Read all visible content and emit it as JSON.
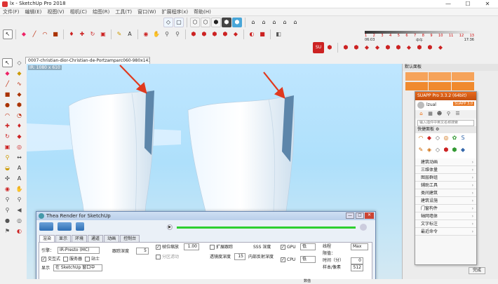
{
  "window": {
    "title": "lx - SketchUp Pro 2018",
    "minimize": "—",
    "maximize": "☐",
    "close": "✕"
  },
  "menu": [
    "文件(F)",
    "编辑(E)",
    "视图(V)",
    "相机(C)",
    "绘图(R)",
    "工具(T)",
    "窗口(W)",
    "扩展程序(x)",
    "帮助(H)"
  ],
  "toolbars": {
    "row1_icons": [
      "select-icon",
      "eraser-icon",
      "pencil-icon",
      "arc-icon",
      "paint-icon",
      "push-pull-icon",
      "move-icon",
      "rotate-icon",
      "scale-icon",
      "offset-icon",
      "tape-icon",
      "text-icon",
      "orbit-icon",
      "pan-icon",
      "zoom-icon",
      "zoom-extents-icon",
      "component-icon",
      "warehouse-icon"
    ],
    "scale": {
      "ticks": [
        "1",
        "2",
        "3",
        "4",
        "5",
        "6",
        "7",
        "8",
        "9",
        "10",
        "11",
        "12",
        "13"
      ],
      "left_time": "06:03",
      "mid_time": "中午",
      "right_time": "17:36"
    }
  },
  "tab": {
    "label": "0007-christian-dior-Christian-de-Portzamparc060-980x1430"
  },
  "viewport": {
    "resolution_label": "IR: 1080 x 610"
  },
  "right_panel": {
    "title": "默认面板"
  },
  "suapp": {
    "title": "SUAPP Pro 3.3.2 (64bit)",
    "badge": "SUAPP 3.0",
    "user": "lzual",
    "search_placeholder": "输入插件中英文名称搜索",
    "quick_panel": "快捷面板",
    "menu_items": [
      "建筑动画",
      "三维体量",
      "图层群组",
      "辅助工具",
      "类间建筑",
      "建筑设施",
      "门窗构件",
      "轴网墙体",
      "文字标注",
      "最近命令"
    ],
    "done": "完成"
  },
  "thea": {
    "title": "Thea Render for SketchUp",
    "tabs": [
      "渲染",
      "显示",
      "环境",
      "通道",
      "动画",
      "控制台"
    ],
    "engine_label": "引擎：",
    "engine_value": "IR-Presto (MC)",
    "interactive_label": "交互式",
    "server_label": "服务器",
    "viewport_label": "站士",
    "display_label": "显示",
    "display_value": "在 SketchUp 窗口中",
    "trace_depth_label": "跟踪深度",
    "trace_depth_value": "5",
    "res_scale_label": "帧位缩放",
    "res_scale_value": "1.00",
    "denoise_label": "分区滤动",
    "extended_tracing_label": "扩展跟踪",
    "sss_label": "SSS 深度",
    "transparency_depth_label": "透镜度深度",
    "transparency_depth_value": "15",
    "internal_reflect_label": "内部反射深度",
    "gpu_label": "GPU",
    "gpu_value": "低",
    "cpu_label": "CPU",
    "cpu_value": "低",
    "threads_label": "线程",
    "threads_value": "Max",
    "priority_label": "限值：",
    "time_label": "时间（分）",
    "time_value": "0",
    "samples_label": "样本/像素",
    "samples_value": "512"
  },
  "status": {
    "tray": "数值"
  }
}
